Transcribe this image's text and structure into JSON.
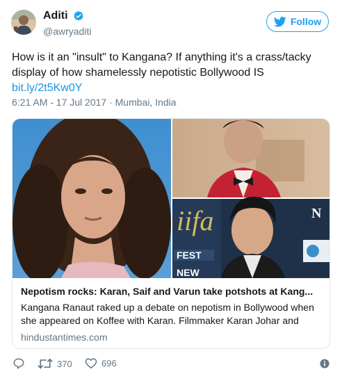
{
  "author": {
    "display_name": "Aditi",
    "handle": "@awryaditi",
    "verified": true
  },
  "follow_button": {
    "label": "Follow",
    "icon": "twitter-bird-icon"
  },
  "tweet": {
    "text": "How is it an \"insult\" to Kangana? If anything it's a crass/tacky display of how shamelessly nepotistic Bollywood IS",
    "link": "bit.ly/2t5Kw0Y",
    "timestamp": "6:21 AM - 17 Jul 2017 · Mumbai, India"
  },
  "card": {
    "title": "Nepotism rocks: Karan, Saif and Varun take potshots at Kang...",
    "description": "Kangana Ranaut raked up a debate on nepotism in Bollywood when she appeared on Koffee with Karan. Filmmaker Karan Johar and",
    "domain": "hindustantimes.com",
    "image_text": {
      "iifa": "iifa",
      "fest": "FEST",
      "new": "NEW",
      "n": "N"
    }
  },
  "actions": {
    "reply_icon": "reply-icon",
    "retweet_count": "370",
    "like_count": "696",
    "info_icon": "info-icon"
  },
  "colors": {
    "accent": "#1da1f2",
    "text": "#14171a",
    "muted": "#657786",
    "border": "#e1e8ed"
  }
}
